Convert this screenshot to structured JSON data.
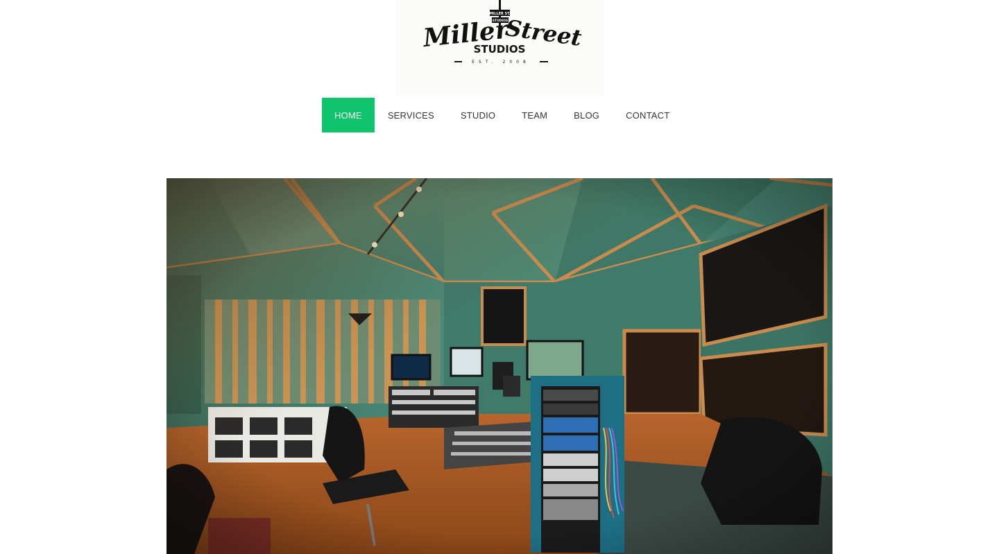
{
  "logo": {
    "sign_top": "MILLER ST.",
    "sign_bottom": "STUDIOS",
    "script_left": "Miller",
    "script_right": "Street",
    "studios": "STUDIOS",
    "est": "EST. 2008"
  },
  "nav": {
    "items": [
      {
        "label": "HOME",
        "active": true
      },
      {
        "label": "SERVICES",
        "active": false
      },
      {
        "label": "STUDIO",
        "active": false
      },
      {
        "label": "TEAM",
        "active": false
      },
      {
        "label": "BLOG",
        "active": false
      },
      {
        "label": "CONTACT",
        "active": false
      }
    ]
  },
  "hero": {
    "subject": "recording-studio-control-room-photo"
  },
  "colors": {
    "accent": "#10c46b",
    "nav_text": "#333333",
    "wall": "#3f7a6c",
    "wood_trim": "#c88a4a",
    "floor": "#c26a2e"
  }
}
